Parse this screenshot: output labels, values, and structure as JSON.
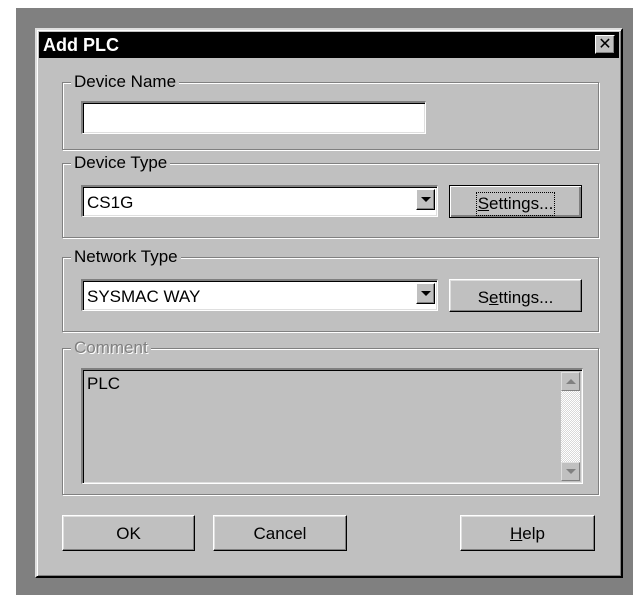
{
  "window": {
    "title": "Add PLC",
    "close_glyph": "✕"
  },
  "device_name": {
    "legend": "Device Name",
    "value": ""
  },
  "device_type": {
    "legend": "Device Type",
    "selected": "CS1G",
    "settings_label_pre": "",
    "settings_mnemonic": "S",
    "settings_label_post": "ettings..."
  },
  "network_type": {
    "legend": "Network Type",
    "selected": "SYSMAC WAY",
    "settings_label_pre": "S",
    "settings_mnemonic": "e",
    "settings_label_post": "ttings..."
  },
  "comment": {
    "legend": "Comment",
    "value": "PLC",
    "enabled": false
  },
  "buttons": {
    "ok": "OK",
    "cancel": "Cancel",
    "help_mnemonic": "H",
    "help_post": "elp"
  },
  "icons": {
    "dropdown": "chevron-down-icon",
    "scroll_up": "arrow-up-icon",
    "scroll_down": "arrow-down-icon",
    "close": "close-icon"
  },
  "colors": {
    "face": "#c0c0c0",
    "titlebar": "#000000",
    "disabled_text": "#808080"
  }
}
